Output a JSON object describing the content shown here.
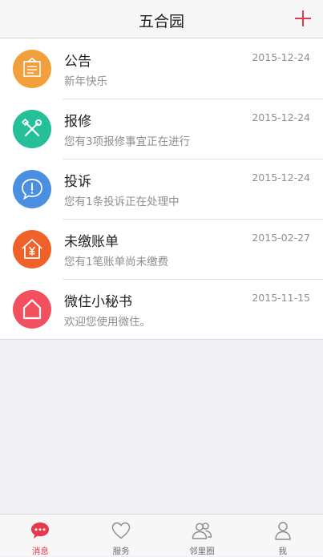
{
  "header": {
    "title": "五合园"
  },
  "colors": {
    "accent": "#e8384b",
    "notice": "#f2a03d",
    "repair": "#25c09a",
    "complaint": "#4a8fe2",
    "bill": "#f0612a",
    "secretary": "#f2505f"
  },
  "messages": [
    {
      "title": "公告",
      "subtitle": "新年快乐",
      "date": "2015-12-24",
      "icon": "notice-board-icon"
    },
    {
      "title": "报修",
      "subtitle": "您有3项报修事宜正在进行",
      "date": "2015-12-24",
      "icon": "wrench-screwdriver-icon"
    },
    {
      "title": "投诉",
      "subtitle": "您有1条投诉正在处理中",
      "date": "2015-12-24",
      "icon": "speech-bubble-alert-icon"
    },
    {
      "title": "未缴账单",
      "subtitle": "您有1笔账单尚未缴费",
      "date": "2015-02-27",
      "icon": "house-yen-icon"
    },
    {
      "title": "微住小秘书",
      "subtitle": "欢迎您使用微住。",
      "date": "2015-11-15",
      "icon": "house-icon"
    }
  ],
  "tabs": [
    {
      "label": "消息",
      "icon": "chat-bubble-icon",
      "active": true
    },
    {
      "label": "服务",
      "icon": "heart-icon",
      "active": false
    },
    {
      "label": "邻里圈",
      "icon": "people-icon",
      "active": false
    },
    {
      "label": "我",
      "icon": "person-icon",
      "active": false
    }
  ]
}
